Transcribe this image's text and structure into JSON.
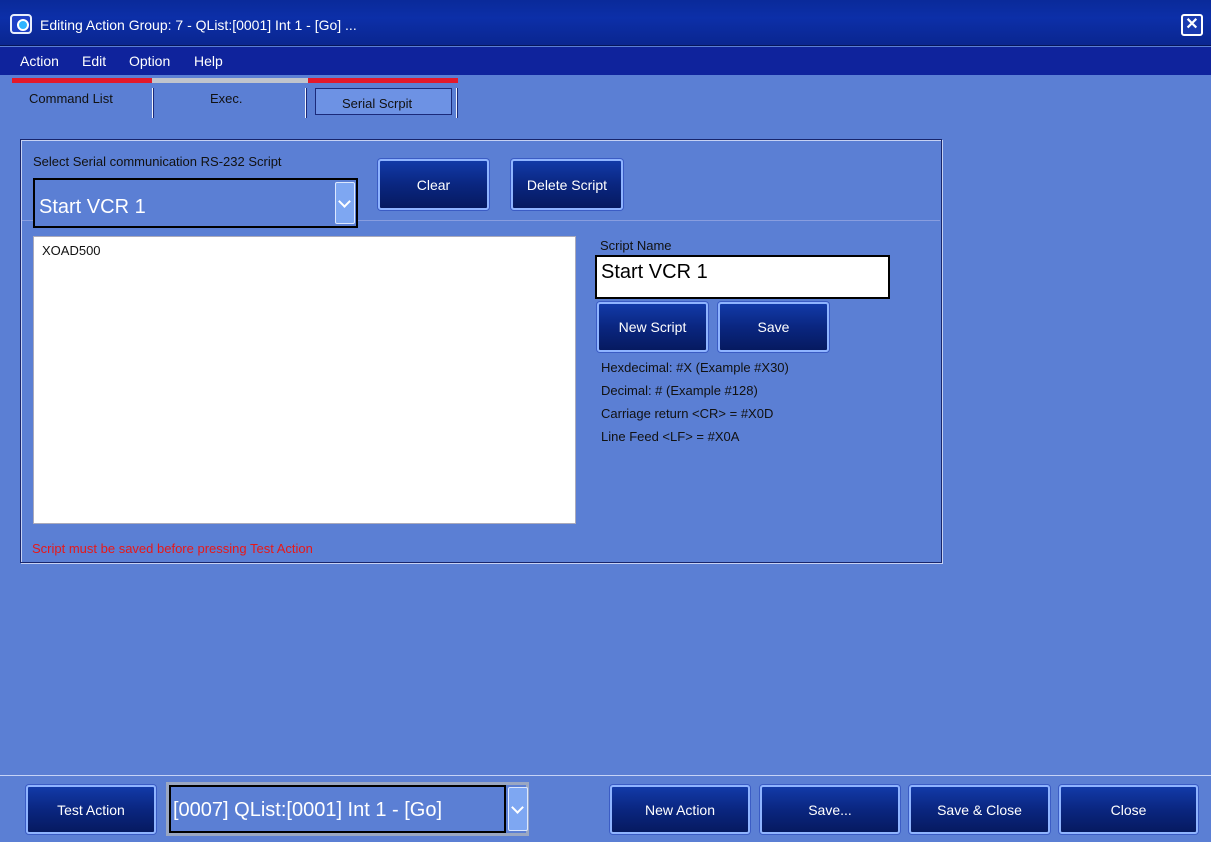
{
  "window": {
    "title": "Editing Action Group: 7 - QList:[0001] Int 1 - [Go] ...",
    "close_icon": "close-icon"
  },
  "menu": [
    "Action",
    "Edit",
    "Option",
    "Help"
  ],
  "tabs": [
    {
      "label": "Command List",
      "active": false
    },
    {
      "label": "Exec.",
      "active": false
    },
    {
      "label": "Serial Scrpit",
      "active": true
    }
  ],
  "colors": {
    "background": "#5b7fd4",
    "titlebar": "#0c2fa8",
    "menubar": "#0f239c",
    "tab_active_line": "#e3192b",
    "warning": "#e81818"
  },
  "serial": {
    "select_label": "Select Serial communication RS-232 Script",
    "selected_script": "Start VCR 1",
    "clear_label": "Clear",
    "delete_label": "Delete Script",
    "script_text": "XOAD500",
    "script_name_label": "Script Name",
    "script_name_value": "Start VCR 1",
    "new_script_label": "New Script",
    "save_label": "Save",
    "help": [
      "Hexdecimal: #X   (Example #X30)",
      "Decimal: #   (Example #128)",
      "Carriage return <CR> = #X0D",
      "Line Feed <LF> = #X0A"
    ],
    "warning": "Script must be saved before pressing Test Action"
  },
  "bottom": {
    "test_action_label": "Test Action",
    "action_select_value": "[0007] QList:[0001] Int 1 - [Go]",
    "new_action_label": "New Action",
    "save_label": "Save...",
    "save_close_label": "Save & Close",
    "close_label": "Close"
  }
}
